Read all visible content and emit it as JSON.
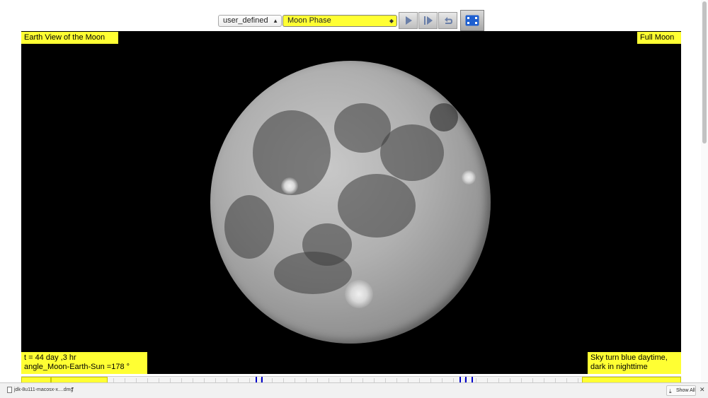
{
  "toolbar": {
    "mode_select": {
      "value": "user_defined"
    },
    "view_select": {
      "value": "Moon Phase"
    },
    "icons": {
      "play": "play-icon",
      "step": "step-forward-icon",
      "reset": "reset-icon",
      "fullscreen": "fullscreen-icon"
    }
  },
  "view": {
    "title": "Earth View of the Moon",
    "phase": "Full Moon",
    "time": "t = 44 day ,3 hr",
    "angle": "angle_Moon-Earth-Sun =178 °",
    "sky_line1": "Sky turn blue daytime,",
    "sky_line2": "dark in nighttime"
  },
  "download_bar": {
    "file_name": "jdk-8u111-macosx-x....dmg",
    "show_all": "Show All"
  },
  "colors": {
    "label_bg": "#ffff33",
    "view_bg": "#000000",
    "timeline_marker": "#0000cc"
  }
}
